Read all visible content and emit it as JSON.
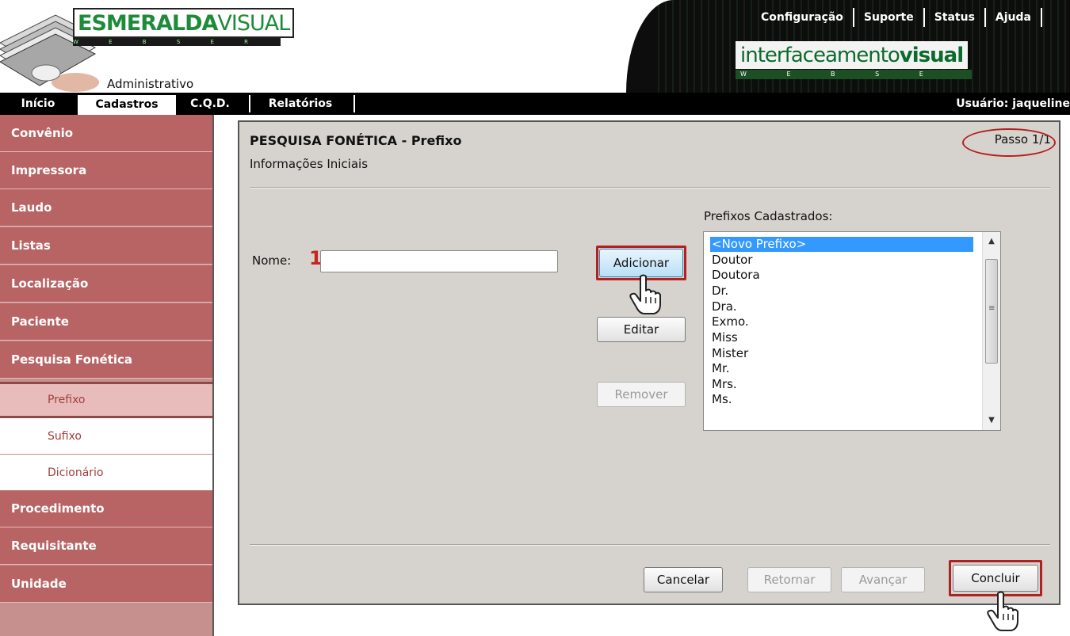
{
  "header": {
    "brand_left_bold": "ESMERALDA",
    "brand_left_light": "VISUAL",
    "brand_left_strip": "W E B S E R V I C E",
    "subtitle": "Administrativo",
    "top_menu": [
      "Configuração",
      "Suporte",
      "Status",
      "Ajuda"
    ],
    "brand_right_light": "interfaceamento",
    "brand_right_bold": "visual",
    "brand_right_strip": "W E B S E R V I C E"
  },
  "nav": {
    "items": [
      "Início",
      "Cadastros",
      "C.Q.D.",
      "Relatórios"
    ],
    "active": "Cadastros",
    "user": "Usuário: jaqueline"
  },
  "sidebar": {
    "items": [
      "Convênio",
      "Impressora",
      "Laudo",
      "Listas",
      "Localização",
      "Paciente",
      "Pesquisa Fonética"
    ],
    "sub_items": [
      "Prefixo",
      "Sufixo",
      "Dicionário"
    ],
    "active_sub": "Prefixo",
    "items_after": [
      "Procedimento",
      "Requisitante",
      "Unidade"
    ]
  },
  "panel": {
    "title": "PESQUISA FONÉTICA - Prefixo",
    "subtitle": "Informações Iniciais",
    "step": "Passo 1/1",
    "name_label": "Nome:",
    "name_marker": "1",
    "name_value": "",
    "buttons": {
      "add": "Adicionar",
      "edit": "Editar",
      "remove": "Remover"
    },
    "list_label": "Prefixos Cadastrados:",
    "list_items": [
      "<Novo Prefixo>",
      "Doutor",
      "Doutora",
      "Dr.",
      "Dra.",
      "Exmo.",
      "Miss",
      "Mister",
      "Mr.",
      "Mrs.",
      "Ms."
    ],
    "list_selected": "<Novo Prefixo>",
    "footer": {
      "cancel": "Cancelar",
      "back": "Retornar",
      "next": "Avançar",
      "finish": "Concluir"
    }
  },
  "colors": {
    "sidebar_item": "#b96464",
    "highlight": "#b32020",
    "panel_bg": "#d6d3ce",
    "brand_green": "#1e8b3a"
  }
}
